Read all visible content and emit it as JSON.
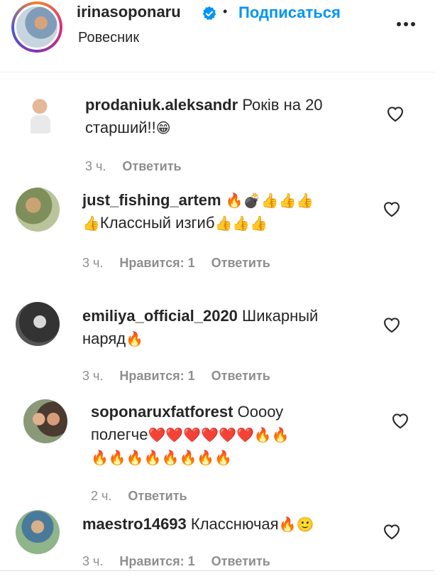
{
  "post_header": {
    "username": "irinasoponaru",
    "separator": "•",
    "follow_label": "Подписаться",
    "subtitle": "Ровесник"
  },
  "icons": {
    "verified": "verified-badge-icon",
    "more": "more-options-icon",
    "like": "heart-outline-icon"
  },
  "colors": {
    "link": "#0095f6",
    "text": "#262626",
    "meta": "#8e8e8e"
  },
  "comments": [
    {
      "username": "prodaniuk.aleksandr",
      "line1": "Років на 20",
      "line2": "старший!!",
      "line2_emoji": "😁",
      "time": "3 ч.",
      "likes": "",
      "reply": "Ответить"
    },
    {
      "username": "just_fishing_artem",
      "line1_emoji": "🔥💣👍👍👍",
      "line2_emoji_pre": "👍",
      "line2": "Классный изгиб",
      "line2_emoji": "👍👍👍",
      "time": "3 ч.",
      "likes": "Нравится: 1",
      "reply": "Ответить"
    },
    {
      "username": "emiliya_official_2020",
      "line1": "Шикарный",
      "line2": "наряд",
      "line2_emoji": "🔥",
      "time": "3 ч.",
      "likes": "Нравится: 1",
      "reply": "Ответить"
    },
    {
      "username": "soponaruxfatforest",
      "line1": "Ооооу",
      "line2": "полегче",
      "line2_emoji": "❤️❤️❤️❤️❤️❤️🔥🔥",
      "line3_emoji": "🔥🔥🔥🔥🔥🔥🔥🔥",
      "time": "2 ч.",
      "likes": "",
      "reply": "Ответить"
    },
    {
      "username": "maestro14693",
      "line1": "Класснючая",
      "line1_emoji": "🔥🙂",
      "time": "3 ч.",
      "likes": "Нравится: 1",
      "reply": "Ответить"
    }
  ]
}
